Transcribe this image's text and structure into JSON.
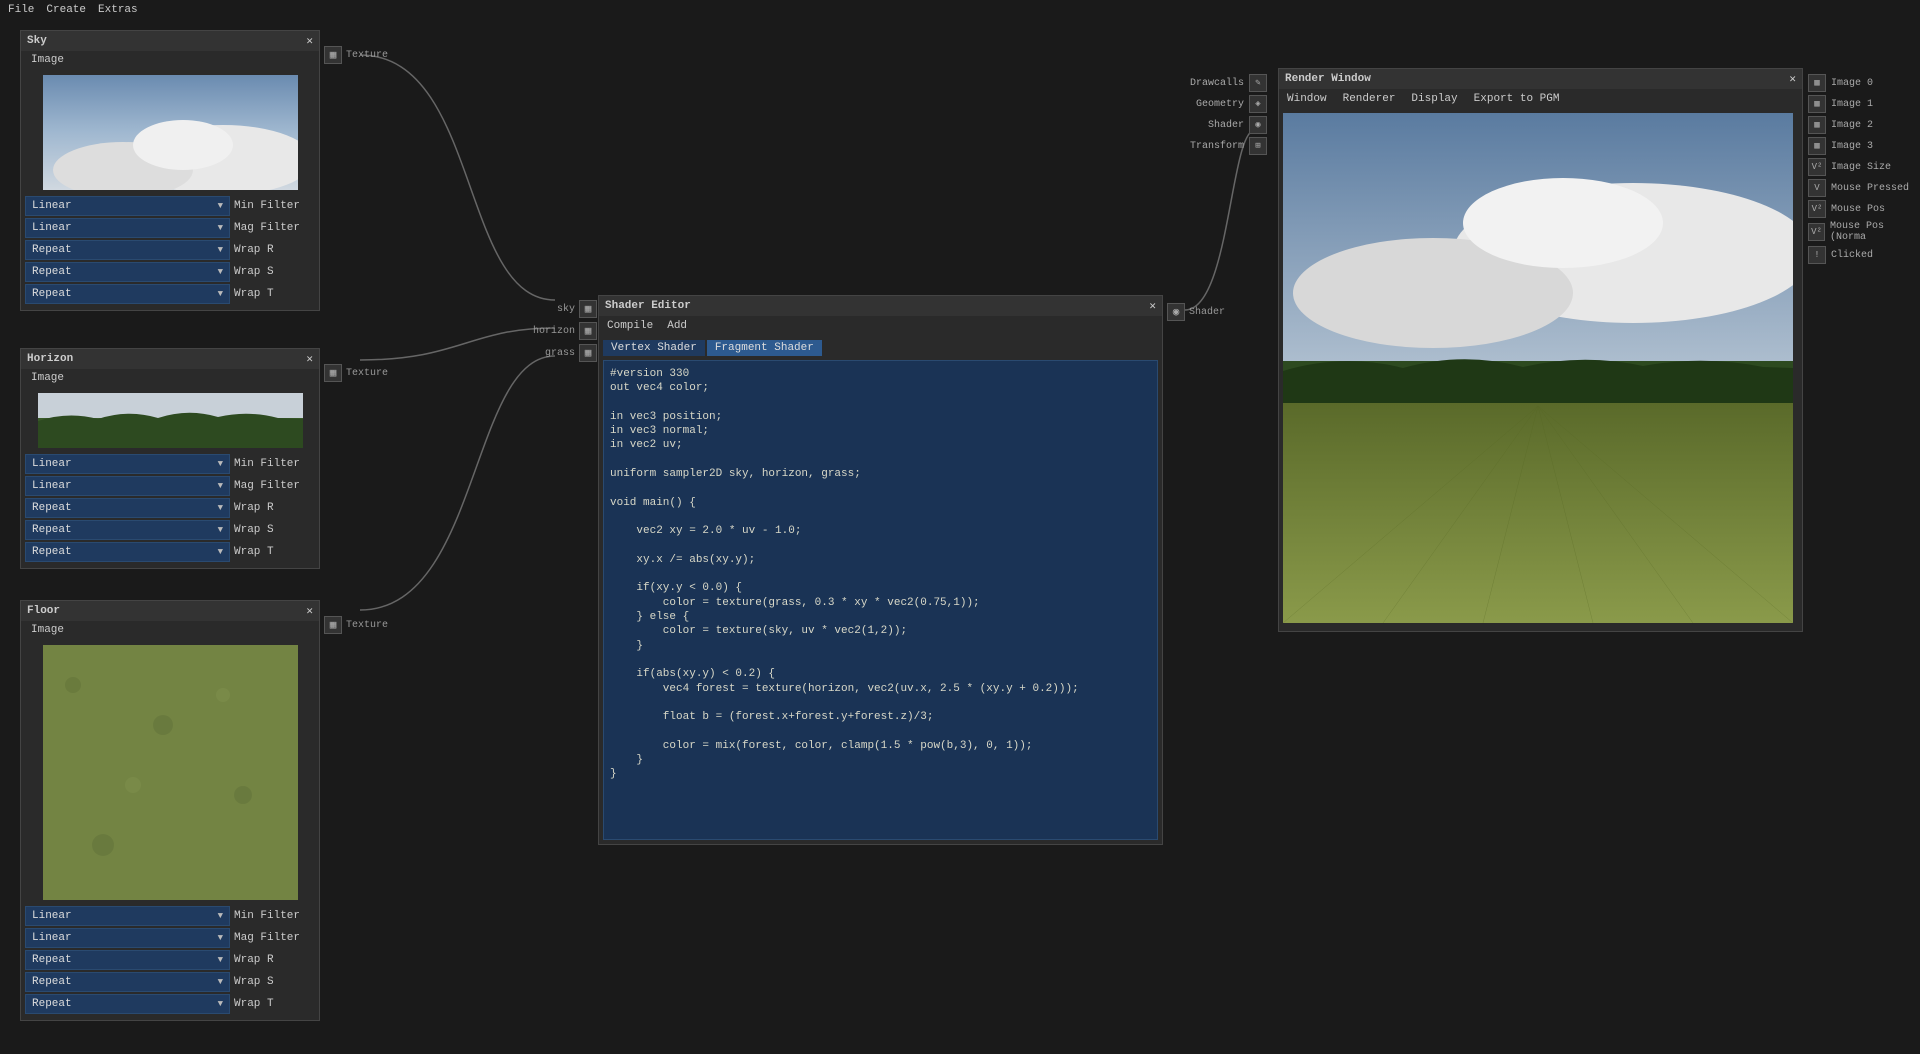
{
  "menu": {
    "file": "File",
    "create": "Create",
    "extras": "Extras"
  },
  "textureSocketLabel": "Texture",
  "texturePanels": [
    {
      "title": "Sky",
      "sub": "Image",
      "props": [
        {
          "val": "Linear",
          "lbl": "Min Filter"
        },
        {
          "val": "Linear",
          "lbl": "Mag Filter"
        },
        {
          "val": "Repeat",
          "lbl": "Wrap R"
        },
        {
          "val": "Repeat",
          "lbl": "Wrap S"
        },
        {
          "val": "Repeat",
          "lbl": "Wrap T"
        }
      ]
    },
    {
      "title": "Horizon",
      "sub": "Image",
      "props": [
        {
          "val": "Linear",
          "lbl": "Min Filter"
        },
        {
          "val": "Linear",
          "lbl": "Mag Filter"
        },
        {
          "val": "Repeat",
          "lbl": "Wrap R"
        },
        {
          "val": "Repeat",
          "lbl": "Wrap S"
        },
        {
          "val": "Repeat",
          "lbl": "Wrap T"
        }
      ]
    },
    {
      "title": "Floor",
      "sub": "Image",
      "props": [
        {
          "val": "Linear",
          "lbl": "Min Filter"
        },
        {
          "val": "Linear",
          "lbl": "Mag Filter"
        },
        {
          "val": "Repeat",
          "lbl": "Wrap R"
        },
        {
          "val": "Repeat",
          "lbl": "Wrap S"
        },
        {
          "val": "Repeat",
          "lbl": "Wrap T"
        }
      ]
    }
  ],
  "shaderEditor": {
    "title": "Shader Editor",
    "menu": {
      "compile": "Compile",
      "add": "Add"
    },
    "tabs": {
      "vertex": "Vertex Shader",
      "fragment": "Fragment Shader"
    },
    "inputs": [
      "sky",
      "horizon",
      "grass"
    ],
    "outputLabel": "Shader",
    "code": "#version 330\nout vec4 color;\n\nin vec3 position;\nin vec3 normal;\nin vec2 uv;\n\nuniform sampler2D sky, horizon, grass;\n\nvoid main() {\n\n    vec2 xy = 2.0 * uv - 1.0;\n\n    xy.x /= abs(xy.y);\n\n    if(xy.y < 0.0) {\n        color = texture(grass, 0.3 * xy * vec2(0.75,1));\n    } else {\n        color = texture(sky, uv * vec2(1,2));\n    }\n\n    if(abs(xy.y) < 0.2) {\n        vec4 forest = texture(horizon, vec2(uv.x, 2.5 * (xy.y + 0.2)));\n\n        float b = (forest.x+forest.y+forest.z)/3;\n\n        color = mix(forest, color, clamp(1.5 * pow(b,3), 0, 1));\n    }\n}"
  },
  "renderInputs": [
    "Drawcalls",
    "Geometry",
    "Shader",
    "Transform"
  ],
  "renderWindow": {
    "title": "Render Window",
    "menu": {
      "window": "Window",
      "renderer": "Renderer",
      "display": "Display",
      "export": "Export to PGM"
    }
  },
  "renderOutputs": [
    "Image 0",
    "Image 1",
    "Image 2",
    "Image 3",
    "Image Size",
    "Mouse Pressed",
    "Mouse Pos",
    "Mouse Pos (Norma",
    "Clicked"
  ],
  "outputIcons": [
    "▦",
    "▦",
    "▦",
    "▦",
    "V²",
    "V",
    "V²",
    "V²",
    "!"
  ]
}
